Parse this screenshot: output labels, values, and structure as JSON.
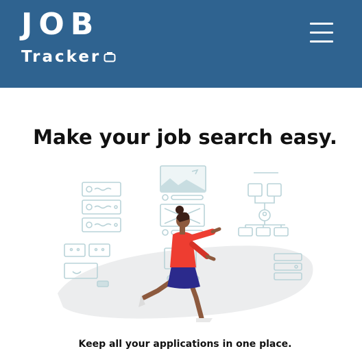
{
  "header": {
    "logo_main": "JOB",
    "logo_sub": "Tracker",
    "logo_icon": "briefcase-icon",
    "menu_icon": "hamburger-menu-icon",
    "background_color": "#2f6390"
  },
  "hero": {
    "headline": "Make your job search easy.",
    "illustration": "person-walking-with-sketches-illustration",
    "tagline": "Keep all your applications in one place."
  }
}
